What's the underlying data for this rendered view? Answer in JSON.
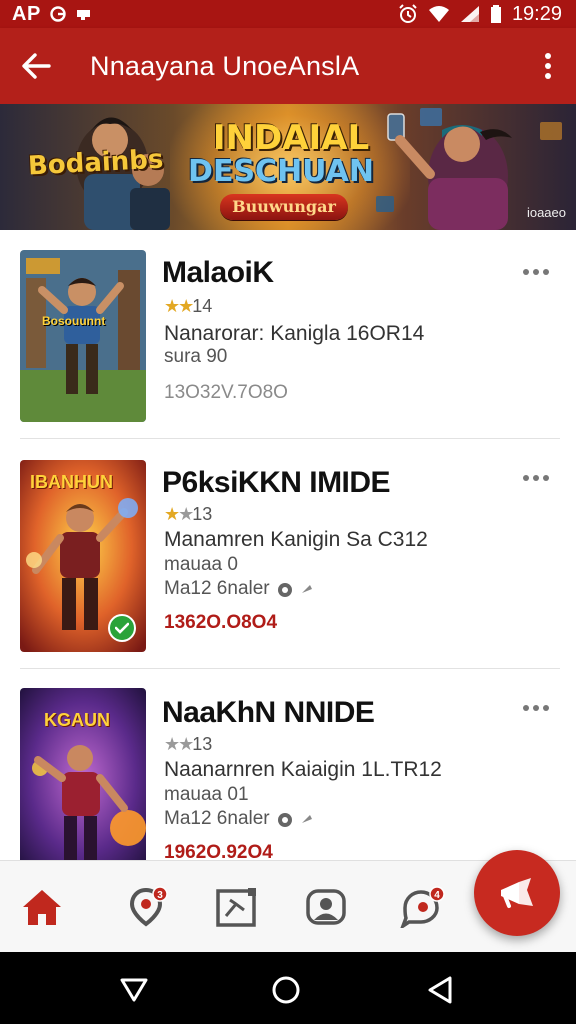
{
  "status_bar": {
    "left_text": "AP",
    "time": "19:29"
  },
  "app_bar": {
    "title": "Nnaayana UnoeAnslA"
  },
  "banner": {
    "left_text": "Bodainbs",
    "title_line1": "INDAIAL",
    "title_line2": "DESCHUAN",
    "ribbon": "Buuwungar",
    "corner_text": "ioaaeo"
  },
  "games": [
    {
      "title": "MalaoiK",
      "rating": "14",
      "stars_filled": 2,
      "line1": "Nanarorar: Kanigla 16OR14",
      "line2": "sura 90",
      "price": "13O32V.7O8O",
      "price_style": "gray",
      "thumb_caption": "Bosouunnt",
      "verified": false
    },
    {
      "title": "P6ksiKKN IMIDE",
      "rating": "13",
      "stars_filled": 1,
      "line1": "Manamren Kanigin Sa C312",
      "line2": "mauaa 0",
      "line3": "Ma12 6naler",
      "price": "1362O.O8O4",
      "price_style": "red",
      "thumb_caption": "IBANHUN",
      "verified": true
    },
    {
      "title": "NaaKhN NNIDE",
      "rating": "13",
      "stars_filled": 0,
      "line1": "Naanarnren Kaiaigin 1L.TR12",
      "line2": "mauaa 01",
      "line3": "Ma12 6naler",
      "price": "1962O.92O4",
      "price_style": "red",
      "thumb_caption": "KGAUN",
      "verified": false
    }
  ],
  "bottom_nav": {
    "items": [
      "home-icon",
      "map-pin-icon",
      "store-icon",
      "profile-icon",
      "chat-icon"
    ],
    "badges": {
      "map": "3",
      "chat": "4"
    }
  },
  "colors": {
    "primary": "#b3201a",
    "status": "#a81512",
    "price_red": "#b01c18",
    "fab": "#c72a20"
  }
}
